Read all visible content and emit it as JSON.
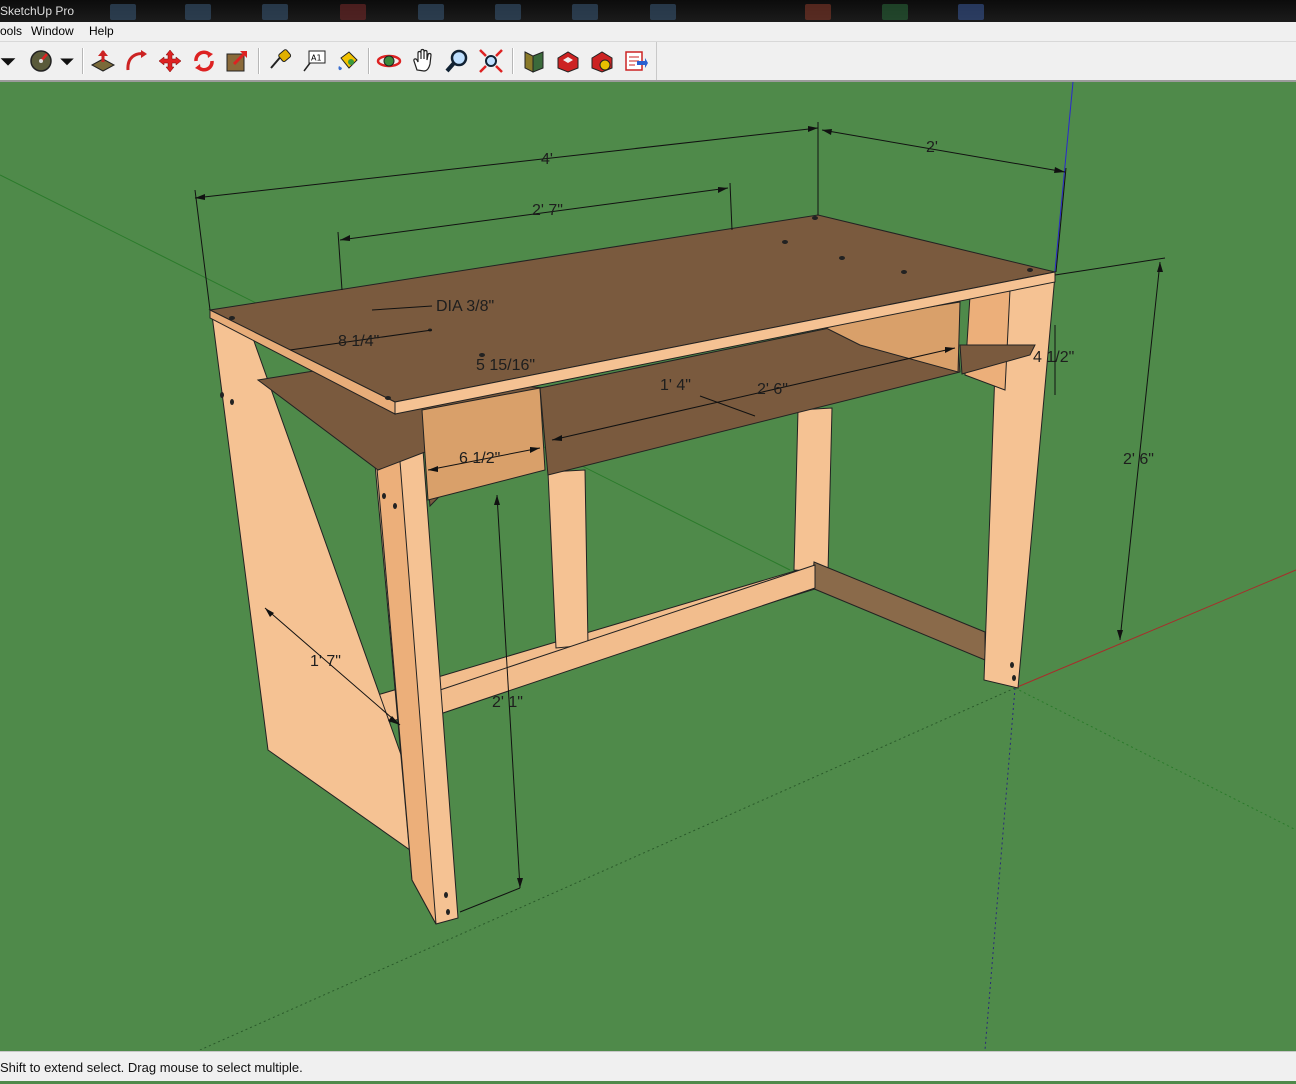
{
  "window": {
    "title": "SketchUp Pro"
  },
  "menu": {
    "items": [
      "ools",
      "Window",
      "Help"
    ]
  },
  "toolbar": {
    "tools": [
      "select-dropdown",
      "compass",
      "compass-dropdown",
      "push-pull",
      "follow-me",
      "move",
      "rotate",
      "scale",
      "tape-measure",
      "text",
      "paint-bucket",
      "orbit",
      "pan",
      "zoom",
      "zoom-extents",
      "components",
      "3d-warehouse",
      "share-model",
      "send-to-layout"
    ]
  },
  "viewport": {
    "dimensions": {
      "width_top": "4'",
      "depth_top": "2'",
      "shelf_span": "2' 7\"",
      "hole_dia": "DIA 3/8\"",
      "hole_offset": "8 1/4\"",
      "hole_small": "5 15/16\"",
      "shelf_depth": "1' 4\"",
      "shelf_width": "2' 6\"",
      "cubby_width": "6 1/2\"",
      "apron_height": "4 1/2\"",
      "total_height": "2' 6\"",
      "leg_span": "1' 7\"",
      "under_height": "2' 1\""
    },
    "colors": {
      "ground": "#4f8a4a",
      "wood_top": "#7a5a3e",
      "wood_edge": "#f5c293",
      "wood_side": "#e8ad79"
    }
  },
  "status": {
    "message": "Shift to extend select. Drag mouse to select multiple."
  }
}
